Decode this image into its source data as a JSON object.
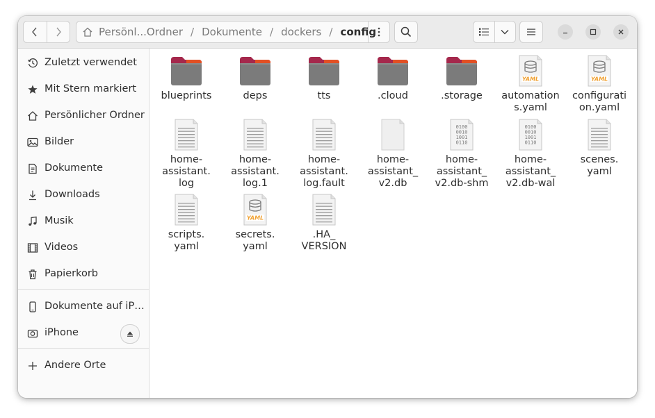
{
  "header": {
    "path": [
      {
        "label": "Persönl...Ordner"
      },
      {
        "label": "Dokumente"
      },
      {
        "label": "dockers"
      },
      {
        "label": "config"
      }
    ]
  },
  "icons": {
    "back": "chevron-left-icon",
    "forward": "chevron-right-icon",
    "home": "home-icon",
    "path_menu": "vertical-dots-icon",
    "search": "search-icon",
    "list_view": "list-view-icon",
    "view_options": "chevron-down-icon",
    "main_menu": "hamburger-icon",
    "minimize": "minimize-icon",
    "maximize": "maximize-icon",
    "close": "close-icon"
  },
  "sidebar": {
    "items": [
      {
        "label": "Zuletzt verwendet",
        "icon": "clock-icon"
      },
      {
        "label": "Mit Stern markiert",
        "icon": "star-icon"
      },
      {
        "label": "Persönlicher Ordner",
        "icon": "home-icon"
      },
      {
        "label": "Bilder",
        "icon": "image-icon"
      },
      {
        "label": "Dokumente",
        "icon": "document-icon"
      },
      {
        "label": "Downloads",
        "icon": "download-icon"
      },
      {
        "label": "Musik",
        "icon": "music-icon"
      },
      {
        "label": "Videos",
        "icon": "film-icon"
      },
      {
        "label": "Papierkorb",
        "icon": "trash-icon"
      }
    ],
    "devices": [
      {
        "label": "Dokumente auf iP…",
        "icon": "phone-icon"
      },
      {
        "label": "iPhone",
        "icon": "camera-icon"
      }
    ],
    "other": {
      "label": "Andere Orte",
      "icon": "plus-icon"
    }
  },
  "files": [
    {
      "name": "blueprints",
      "type": "folder"
    },
    {
      "name": "deps",
      "type": "folder"
    },
    {
      "name": "tts",
      "type": "folder"
    },
    {
      "name": ".cloud",
      "type": "folder"
    },
    {
      "name": ".storage",
      "type": "folder"
    },
    {
      "name": "automation\ns.yaml",
      "type": "yaml"
    },
    {
      "name": "configurati\non.yaml",
      "type": "yaml"
    },
    {
      "name": "home-\nassistant.\nlog",
      "type": "text"
    },
    {
      "name": "home-\nassistant.\nlog.1",
      "type": "text"
    },
    {
      "name": "home-\nassistant.\nlog.fault",
      "type": "text"
    },
    {
      "name": "home-\nassistant_\nv2.db",
      "type": "blank"
    },
    {
      "name": "home-\nassistant_\nv2.db-shm",
      "type": "binary"
    },
    {
      "name": "home-\nassistant_\nv2.db-wal",
      "type": "binary"
    },
    {
      "name": "scenes.\nyaml",
      "type": "text"
    },
    {
      "name": "scripts.\nyaml",
      "type": "text"
    },
    {
      "name": "secrets.\nyaml",
      "type": "yaml"
    },
    {
      "name": ".HA_\nVERSION",
      "type": "text"
    }
  ],
  "colors": {
    "folder_body": "#7b7b7b",
    "folder_tab": "#a5284c",
    "folder_accent": "#e95420",
    "yaml_badge": "#f0a030"
  }
}
